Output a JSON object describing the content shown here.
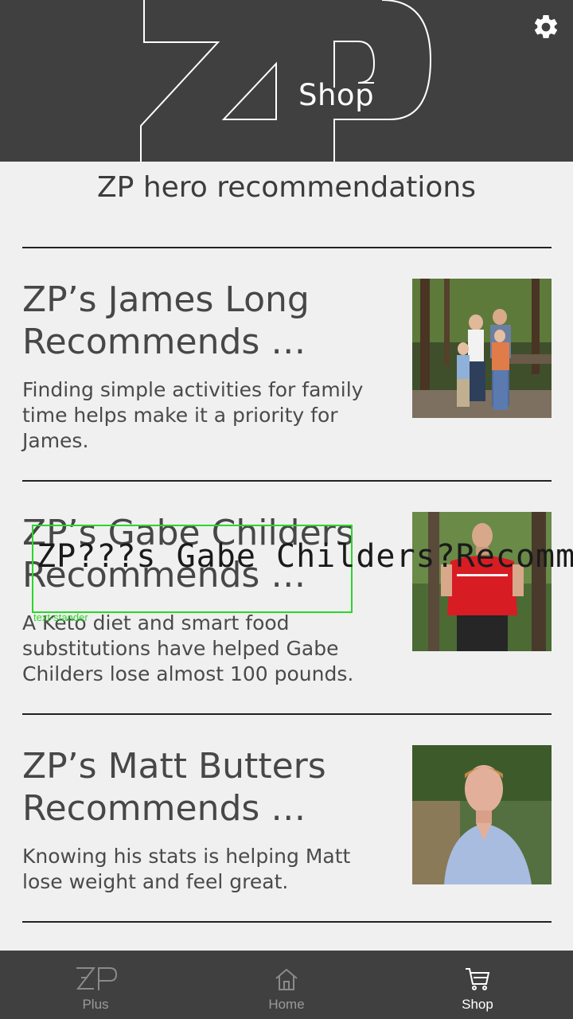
{
  "header": {
    "title": "Shop"
  },
  "section": {
    "title": "ZP hero recommendations"
  },
  "cards": [
    {
      "title_line1": "ZP’s James Long",
      "title_line2": "Recommends …",
      "description": "Finding simple activities for family time helps make it a priority for James."
    },
    {
      "title_line1": "ZP’s Gabe Childers",
      "title_line2": "Recommends …",
      "description": "A Keto diet and smart food substitutions have helped Gabe Childers lose almost 100 pounds."
    },
    {
      "title_line1": "ZP’s Matt Butters",
      "title_line2": "Recommends …",
      "description": "Knowing his stats is helping Matt lose weight and feel great."
    }
  ],
  "overlay": {
    "text": "ZP???s Gabe Childers?Recomm",
    "label": "text-stander"
  },
  "nav": {
    "items": [
      {
        "label": "Plus",
        "icon": "zp-logo-icon",
        "active": false
      },
      {
        "label": "Home",
        "icon": "home-icon",
        "active": false
      },
      {
        "label": "Shop",
        "icon": "cart-icon",
        "active": true
      }
    ]
  },
  "colors": {
    "header_bg": "#404040",
    "page_bg": "#f0f0f0",
    "overlay_box": "#2bd62b"
  }
}
